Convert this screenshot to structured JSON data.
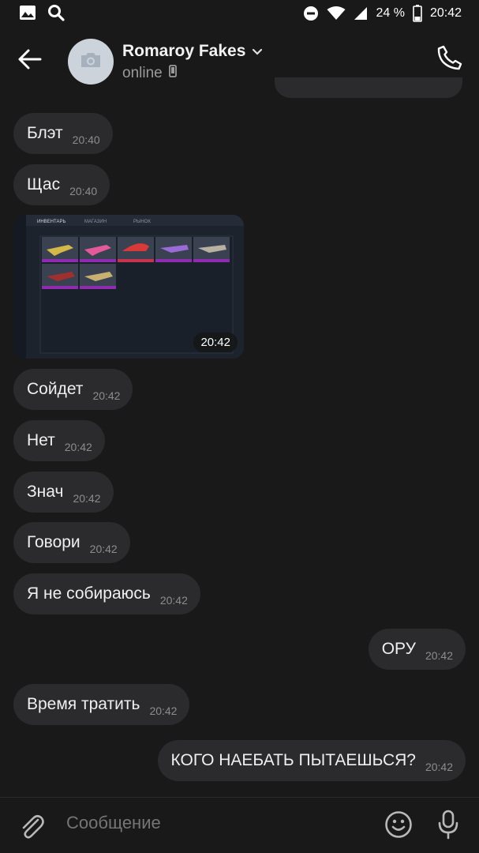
{
  "status_bar": {
    "battery_pct": "24 %",
    "time": "20:42"
  },
  "header": {
    "contact_name": "Romaroy Fakes",
    "status": "online"
  },
  "messages": [
    {
      "dir": "in",
      "text": "Блэт",
      "time": "20:40"
    },
    {
      "dir": "in",
      "text": "Щас",
      "time": "20:40"
    },
    {
      "dir": "in",
      "type": "photo",
      "time": "20:42"
    },
    {
      "dir": "in",
      "text": "Сойдет",
      "time": "20:42"
    },
    {
      "dir": "in",
      "text": "Нет",
      "time": "20:42"
    },
    {
      "dir": "in",
      "text": "Знач",
      "time": "20:42"
    },
    {
      "dir": "in",
      "text": "Говори",
      "time": "20:42"
    },
    {
      "dir": "in",
      "text": "Я не собираюсь",
      "time": "20:42"
    },
    {
      "dir": "out",
      "text": "ОРУ",
      "time": "20:42"
    },
    {
      "dir": "in",
      "text": "Время тратить",
      "time": "20:42"
    },
    {
      "dir": "out",
      "text": "КОГО НАЕБАТЬ ПЫТАЕШЬСЯ?",
      "time": "20:42"
    }
  ],
  "photo_content": {
    "tabs": [
      "ИНВЕНТАРЬ",
      "МАГАЗИН",
      "РЫНОК"
    ]
  },
  "composer": {
    "placeholder": "Сообщение"
  },
  "colors": {
    "background": "#19191a",
    "bubble": "#2b2b2e",
    "text": "#efefef",
    "time": "#8c8c8c",
    "avatar": "#cdd3db"
  }
}
